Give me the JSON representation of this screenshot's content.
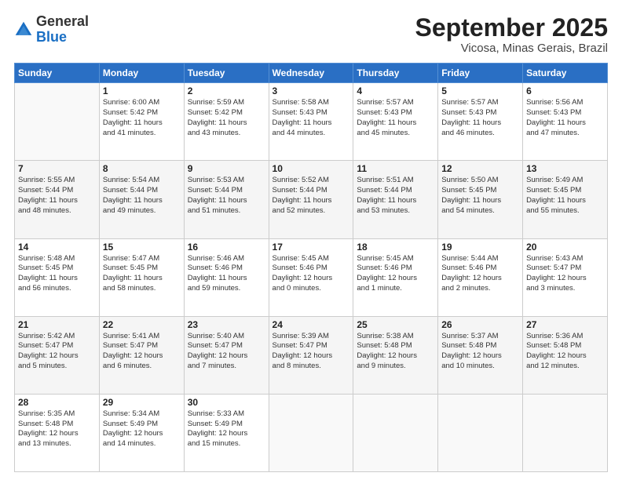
{
  "header": {
    "logo_general": "General",
    "logo_blue": "Blue",
    "month_title": "September 2025",
    "location": "Vicosa, Minas Gerais, Brazil"
  },
  "days_of_week": [
    "Sunday",
    "Monday",
    "Tuesday",
    "Wednesday",
    "Thursday",
    "Friday",
    "Saturday"
  ],
  "weeks": [
    [
      {
        "day": "",
        "info": ""
      },
      {
        "day": "1",
        "info": "Sunrise: 6:00 AM\nSunset: 5:42 PM\nDaylight: 11 hours\nand 41 minutes."
      },
      {
        "day": "2",
        "info": "Sunrise: 5:59 AM\nSunset: 5:42 PM\nDaylight: 11 hours\nand 43 minutes."
      },
      {
        "day": "3",
        "info": "Sunrise: 5:58 AM\nSunset: 5:43 PM\nDaylight: 11 hours\nand 44 minutes."
      },
      {
        "day": "4",
        "info": "Sunrise: 5:57 AM\nSunset: 5:43 PM\nDaylight: 11 hours\nand 45 minutes."
      },
      {
        "day": "5",
        "info": "Sunrise: 5:57 AM\nSunset: 5:43 PM\nDaylight: 11 hours\nand 46 minutes."
      },
      {
        "day": "6",
        "info": "Sunrise: 5:56 AM\nSunset: 5:43 PM\nDaylight: 11 hours\nand 47 minutes."
      }
    ],
    [
      {
        "day": "7",
        "info": "Sunrise: 5:55 AM\nSunset: 5:44 PM\nDaylight: 11 hours\nand 48 minutes."
      },
      {
        "day": "8",
        "info": "Sunrise: 5:54 AM\nSunset: 5:44 PM\nDaylight: 11 hours\nand 49 minutes."
      },
      {
        "day": "9",
        "info": "Sunrise: 5:53 AM\nSunset: 5:44 PM\nDaylight: 11 hours\nand 51 minutes."
      },
      {
        "day": "10",
        "info": "Sunrise: 5:52 AM\nSunset: 5:44 PM\nDaylight: 11 hours\nand 52 minutes."
      },
      {
        "day": "11",
        "info": "Sunrise: 5:51 AM\nSunset: 5:44 PM\nDaylight: 11 hours\nand 53 minutes."
      },
      {
        "day": "12",
        "info": "Sunrise: 5:50 AM\nSunset: 5:45 PM\nDaylight: 11 hours\nand 54 minutes."
      },
      {
        "day": "13",
        "info": "Sunrise: 5:49 AM\nSunset: 5:45 PM\nDaylight: 11 hours\nand 55 minutes."
      }
    ],
    [
      {
        "day": "14",
        "info": "Sunrise: 5:48 AM\nSunset: 5:45 PM\nDaylight: 11 hours\nand 56 minutes."
      },
      {
        "day": "15",
        "info": "Sunrise: 5:47 AM\nSunset: 5:45 PM\nDaylight: 11 hours\nand 58 minutes."
      },
      {
        "day": "16",
        "info": "Sunrise: 5:46 AM\nSunset: 5:46 PM\nDaylight: 11 hours\nand 59 minutes."
      },
      {
        "day": "17",
        "info": "Sunrise: 5:45 AM\nSunset: 5:46 PM\nDaylight: 12 hours\nand 0 minutes."
      },
      {
        "day": "18",
        "info": "Sunrise: 5:45 AM\nSunset: 5:46 PM\nDaylight: 12 hours\nand 1 minute."
      },
      {
        "day": "19",
        "info": "Sunrise: 5:44 AM\nSunset: 5:46 PM\nDaylight: 12 hours\nand 2 minutes."
      },
      {
        "day": "20",
        "info": "Sunrise: 5:43 AM\nSunset: 5:47 PM\nDaylight: 12 hours\nand 3 minutes."
      }
    ],
    [
      {
        "day": "21",
        "info": "Sunrise: 5:42 AM\nSunset: 5:47 PM\nDaylight: 12 hours\nand 5 minutes."
      },
      {
        "day": "22",
        "info": "Sunrise: 5:41 AM\nSunset: 5:47 PM\nDaylight: 12 hours\nand 6 minutes."
      },
      {
        "day": "23",
        "info": "Sunrise: 5:40 AM\nSunset: 5:47 PM\nDaylight: 12 hours\nand 7 minutes."
      },
      {
        "day": "24",
        "info": "Sunrise: 5:39 AM\nSunset: 5:47 PM\nDaylight: 12 hours\nand 8 minutes."
      },
      {
        "day": "25",
        "info": "Sunrise: 5:38 AM\nSunset: 5:48 PM\nDaylight: 12 hours\nand 9 minutes."
      },
      {
        "day": "26",
        "info": "Sunrise: 5:37 AM\nSunset: 5:48 PM\nDaylight: 12 hours\nand 10 minutes."
      },
      {
        "day": "27",
        "info": "Sunrise: 5:36 AM\nSunset: 5:48 PM\nDaylight: 12 hours\nand 12 minutes."
      }
    ],
    [
      {
        "day": "28",
        "info": "Sunrise: 5:35 AM\nSunset: 5:48 PM\nDaylight: 12 hours\nand 13 minutes."
      },
      {
        "day": "29",
        "info": "Sunrise: 5:34 AM\nSunset: 5:49 PM\nDaylight: 12 hours\nand 14 minutes."
      },
      {
        "day": "30",
        "info": "Sunrise: 5:33 AM\nSunset: 5:49 PM\nDaylight: 12 hours\nand 15 minutes."
      },
      {
        "day": "",
        "info": ""
      },
      {
        "day": "",
        "info": ""
      },
      {
        "day": "",
        "info": ""
      },
      {
        "day": "",
        "info": ""
      }
    ]
  ]
}
